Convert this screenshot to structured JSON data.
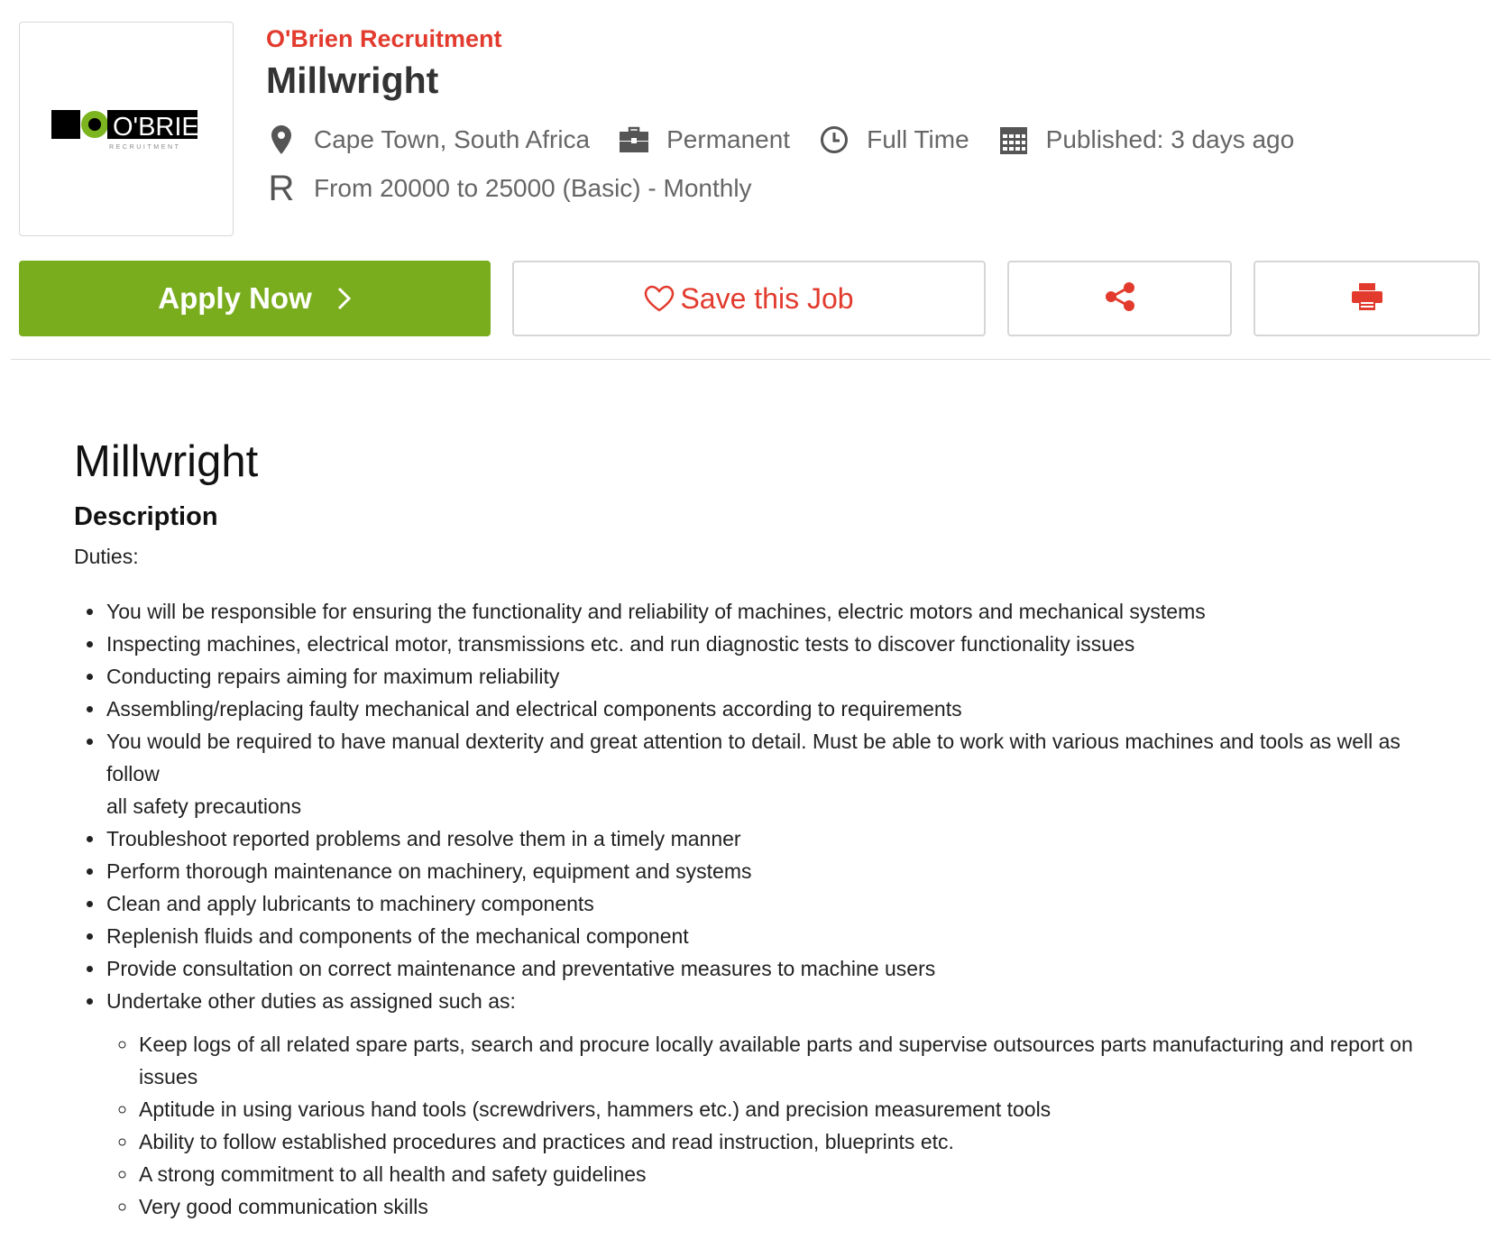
{
  "company": {
    "name": "O'Brien Recruitment",
    "logo_text": "O'BRIEN",
    "logo_subtext": "RECRUITMENT"
  },
  "job": {
    "title": "Millwright",
    "location": "Cape Town, South Africa",
    "contract": "Permanent",
    "hours": "Full Time",
    "published": "Published: 3 days ago",
    "currency_symbol": "R",
    "salary": "From 20000 to 25000 (Basic) - Monthly"
  },
  "icons": {
    "location": "map-pin-icon",
    "contract": "briefcase-icon",
    "hours": "clock-icon",
    "published": "calendar-icon",
    "apply": "chevron-right-icon",
    "save": "heart-icon",
    "share": "share-icon",
    "print": "printer-icon"
  },
  "actions": {
    "apply_label": "Apply Now",
    "save_label": "Save this Job"
  },
  "colors": {
    "accent_red": "#e23b2e",
    "apply_green": "#7aad1e",
    "logo_green": "#7cb51f"
  },
  "description": {
    "heading": "Millwright",
    "section_title": "Description",
    "duties_label": "Duties:",
    "duties": [
      "You will be responsible for ensuring the functionality and reliability of machines, electric motors and mechanical systems",
      "Inspecting machines, electrical motor, transmissions etc. and run diagnostic tests to discover functionality issues",
      "Conducting repairs aiming for maximum reliability",
      "Assembling/replacing faulty mechanical and electrical components according to requirements",
      "You would be required to have manual dexterity and great attention to detail. Must be able to work with various machines and tools as well as follow\nall safety precautions",
      "Troubleshoot reported problems and resolve them in a timely manner",
      "Perform thorough maintenance on machinery, equipment and systems",
      "Clean and apply lubricants to machinery components",
      "Replenish fluids and components of the mechanical component",
      "Provide consultation on correct maintenance and preventative measures to machine users",
      "Undertake other duties as assigned such as:"
    ],
    "sub_duties": [
      "Keep logs of all related spare parts, search and procure locally available parts and supervise outsources parts manufacturing and report on issues",
      "Aptitude in using various hand tools (screwdrivers, hammers etc.) and precision measurement tools",
      "Ability to follow established procedures and practices and read instruction, blueprints etc.",
      "A strong commitment to all health and safety guidelines",
      "Very good communication skills"
    ]
  }
}
